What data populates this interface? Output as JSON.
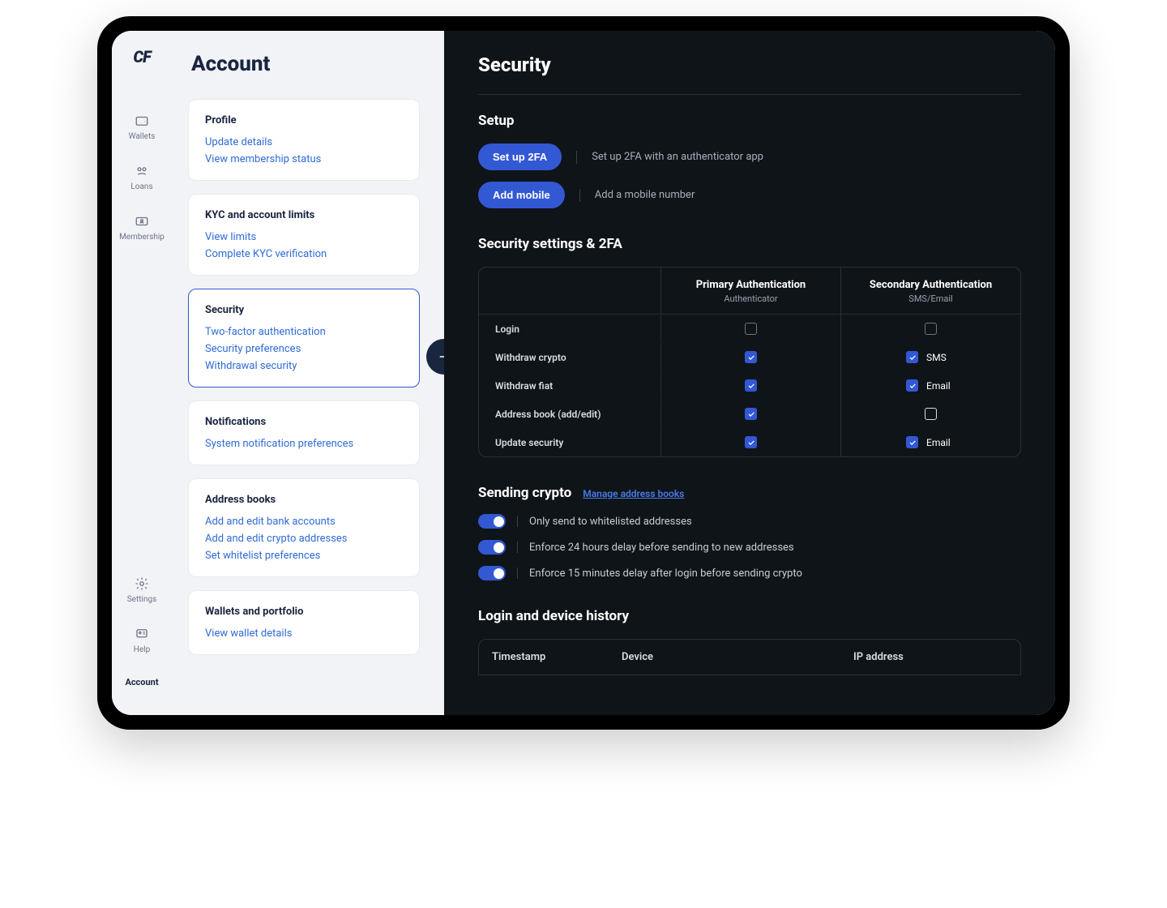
{
  "logo": "CF",
  "nav": {
    "items": [
      {
        "label": "Wallets"
      },
      {
        "label": "Loans"
      },
      {
        "label": "Membership"
      }
    ],
    "bottom": [
      {
        "label": "Settings"
      },
      {
        "label": "Help"
      },
      {
        "label": "Account"
      }
    ]
  },
  "account": {
    "title": "Account",
    "cards": [
      {
        "title": "Profile",
        "links": [
          "Update details",
          "View membership status"
        ]
      },
      {
        "title": "KYC and account limits",
        "links": [
          "View limits",
          "Complete KYC verification"
        ]
      },
      {
        "title": "Security",
        "links": [
          "Two-factor authentication",
          "Security preferences",
          "Withdrawal security"
        ]
      },
      {
        "title": "Notifications",
        "links": [
          "System notification preferences"
        ]
      },
      {
        "title": "Address books",
        "links": [
          "Add and edit bank accounts",
          "Add and edit crypto addresses",
          "Set whitelist preferences"
        ]
      },
      {
        "title": "Wallets and portfolio",
        "links": [
          "View wallet details"
        ]
      }
    ]
  },
  "security": {
    "title": "Security",
    "setup": {
      "heading": "Setup",
      "twofa_btn": "Set up 2FA",
      "twofa_desc": "Set up 2FA with an authenticator app",
      "mobile_btn": "Add mobile",
      "mobile_desc": "Add a mobile number"
    },
    "settings": {
      "heading": "Security settings & 2FA",
      "primary_title": "Primary Authentication",
      "primary_sub": "Authenticator",
      "secondary_title": "Secondary Authentication",
      "secondary_sub": "SMS/Email",
      "rows": [
        {
          "label": "Login"
        },
        {
          "label": "Withdraw crypto",
          "sec_label": "SMS"
        },
        {
          "label": "Withdraw fiat",
          "sec_label": "Email"
        },
        {
          "label": "Address book (add/edit)"
        },
        {
          "label": "Update security",
          "sec_label": "Email"
        }
      ]
    },
    "sending": {
      "heading": "Sending crypto",
      "manage": "Manage address books",
      "toggles": [
        "Only send to whitelisted addresses",
        "Enforce 24 hours delay before sending to new addresses",
        "Enforce 15 minutes delay after login before sending crypto"
      ]
    },
    "history": {
      "heading": "Login and device history",
      "cols": [
        "Timestamp",
        "Device",
        "IP address"
      ]
    }
  }
}
